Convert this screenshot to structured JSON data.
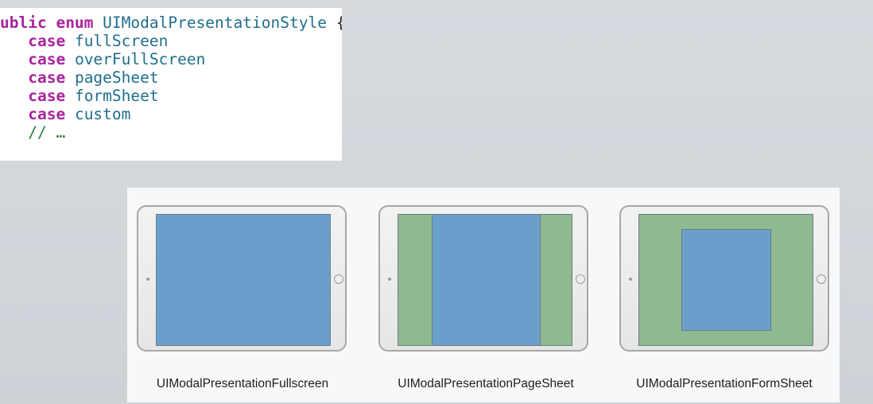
{
  "code": {
    "line1": {
      "kw1": "ublic",
      "kw2": "enum",
      "name": "UIModalPresentationStyle",
      "brace": "{"
    },
    "case_keyword": "case",
    "cases": [
      "fullScreen",
      "overFullScreen",
      "pageSheet",
      "formSheet",
      "custom"
    ],
    "comment": "// …"
  },
  "diagrams": [
    {
      "caption": "UIModalPresentationFullscreen",
      "style": "fullscreen"
    },
    {
      "caption": "UIModalPresentationPageSheet",
      "style": "pageSheet"
    },
    {
      "caption": "UIModalPresentationFormSheet",
      "style": "formSheet"
    }
  ],
  "colors": {
    "keyword": "#a9249d",
    "identifier": "#1f6f8c",
    "presented_view": "#6a9fcc",
    "background_view": "#8fb98f",
    "device_frame": "#a7a7a7"
  }
}
